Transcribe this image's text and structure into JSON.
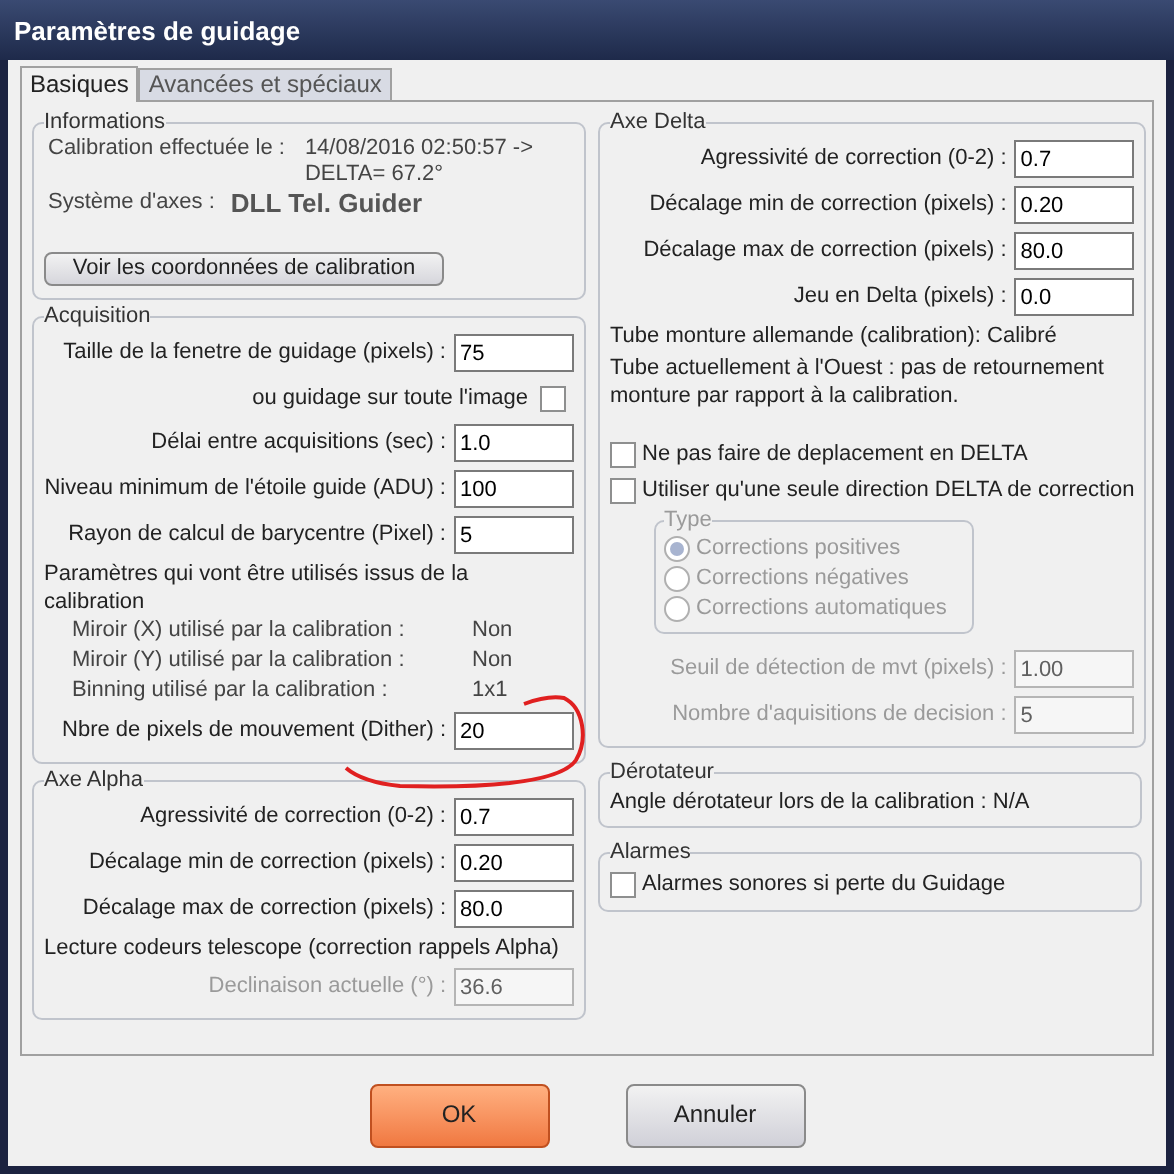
{
  "window": {
    "title": "Paramètres de guidage"
  },
  "tabs": [
    {
      "label": "Basiques",
      "selected": true
    },
    {
      "label": "Avancées et spéciaux",
      "selected": false
    }
  ],
  "informations": {
    "title": "Informations",
    "calibration_label": "Calibration effectuée le :",
    "calibration_value": [
      "14/08/2016 02:50:57 ->",
      "DELTA= 67.2°"
    ],
    "axes_label": "Système d'axes :",
    "axes_value": "DLL Tel. Guider",
    "button": "Voir les coordonnées de calibration"
  },
  "acquisition": {
    "title": "Acquisition",
    "items": [
      {
        "kind": "field",
        "label": "Taille de la fenetre de guidage (pixels) :",
        "value": "75",
        "disabled": false
      },
      {
        "kind": "check-trailing",
        "label": "ou guidage sur toute l'image",
        "checked": false
      },
      {
        "kind": "field",
        "label": "Délai entre acquisitions (sec) :",
        "value": "1.0",
        "disabled": false
      },
      {
        "kind": "field",
        "label": "Niveau minimum de l'étoile guide (ADU) :",
        "value": "100",
        "disabled": false
      },
      {
        "kind": "field",
        "label": "Rayon de calcul de barycentre (Pixel) :",
        "value": "5",
        "disabled": false
      },
      {
        "kind": "note",
        "text": "Paramètres qui vont être utilisés issus de la calibration"
      },
      {
        "kind": "pair",
        "label": "Miroir (X) utilisé par la calibration :",
        "value": "Non"
      },
      {
        "kind": "pair",
        "label": "Miroir (Y) utilisé par la calibration :",
        "value": "Non"
      },
      {
        "kind": "pair",
        "label": "Binning utilisé par la calibration :",
        "value": "1x1"
      },
      {
        "kind": "field",
        "label": "Nbre de pixels de mouvement (Dither) :",
        "value": "20",
        "disabled": false
      }
    ]
  },
  "axe_alpha": {
    "title": "Axe Alpha",
    "items": [
      {
        "kind": "field",
        "label": "Agressivité de correction (0-2) :",
        "value": "0.7",
        "disabled": false
      },
      {
        "kind": "field",
        "label": "Décalage min de correction (pixels) :",
        "value": "0.20",
        "disabled": false
      },
      {
        "kind": "field",
        "label": "Décalage max de correction (pixels) :",
        "value": "80.0",
        "disabled": false
      },
      {
        "kind": "note",
        "text": "Lecture codeurs telescope  (correction rappels Alpha)"
      },
      {
        "kind": "field",
        "label": "Declinaison actuelle (°) :",
        "value": "36.6",
        "disabled": true
      }
    ]
  },
  "axe_delta": {
    "title": "Axe Delta",
    "items": [
      {
        "kind": "field",
        "label": "Agressivité de correction  (0-2) :",
        "value": "0.7",
        "disabled": false
      },
      {
        "kind": "field",
        "label": "Décalage min de correction (pixels) :",
        "value": "0.20",
        "disabled": false
      },
      {
        "kind": "field",
        "label": "Décalage max de correction (pixels) :",
        "value": "80.0",
        "disabled": false
      },
      {
        "kind": "field",
        "label": "Jeu en Delta (pixels) :",
        "value": "0.0",
        "disabled": false
      },
      {
        "kind": "note",
        "text": "Tube monture allemande (calibration): Calibré"
      },
      {
        "kind": "note",
        "text": "Tube actuellement à l'Ouest :  pas de retournement monture par rapport à la calibration."
      },
      {
        "kind": "spacer"
      },
      {
        "kind": "check",
        "label": "Ne pas faire de deplacement en DELTA",
        "checked": false
      },
      {
        "kind": "check",
        "label": "Utiliser qu'une seule direction DELTA de correction",
        "checked": false
      },
      {
        "kind": "radios",
        "title": "Type",
        "disabled": true,
        "options": [
          {
            "label": "Corrections positives",
            "selected": true
          },
          {
            "label": "Corrections négatives",
            "selected": false
          },
          {
            "label": "Corrections automatiques",
            "selected": false
          }
        ]
      },
      {
        "kind": "field",
        "label": "Seuil de détection de mvt (pixels) :",
        "value": "1.00",
        "disabled": true
      },
      {
        "kind": "field",
        "label": "Nombre d'aquisitions de decision :",
        "value": "5",
        "disabled": true
      }
    ]
  },
  "derotateur": {
    "title": "Dérotateur",
    "items": [
      {
        "kind": "note",
        "text": "Angle dérotateur lors de la calibration : N/A"
      }
    ]
  },
  "alarmes": {
    "title": "Alarmes",
    "items": [
      {
        "kind": "check",
        "label": "Alarmes sonores si perte du Guidage",
        "checked": false
      }
    ]
  },
  "buttons": [
    {
      "label": "OK",
      "default": true
    },
    {
      "label": "Annuler",
      "default": false
    }
  ]
}
